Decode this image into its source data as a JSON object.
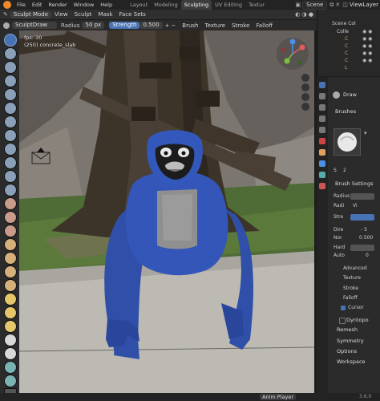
{
  "topbar": {
    "menus": [
      "File",
      "Edit",
      "Render",
      "Window",
      "Help"
    ],
    "tabs": [
      "Layout",
      "Modeling",
      "Sculpting",
      "UV Editing",
      "Textur"
    ],
    "active_tab": "Sculpting",
    "scene": "Scene",
    "view_layer": "ViewLayer"
  },
  "header": {
    "mode": "Sculpt Mode",
    "menus": [
      "View",
      "Sculpt",
      "Mask",
      "Face Sets"
    ],
    "brush_name": "SculptDraw",
    "radius_label": "Radius",
    "radius_value": "50 px",
    "strength_label": "Strength",
    "strength_value": "0.500",
    "right_menus": [
      "Brush",
      "Texture",
      "Stroke",
      "Falloff"
    ]
  },
  "viewport": {
    "info_line1": "fps: 30",
    "info_line2": "(250) concrete_slab"
  },
  "outliner": {
    "title": "Scene Col",
    "rows": [
      "Colle",
      "C",
      "C",
      "C",
      "C",
      "L"
    ]
  },
  "properties": {
    "tool_name": "Draw",
    "brushes_label": "Brushes",
    "brush_slot_label": "S",
    "brush_users": "2",
    "brush_settings_label": "Brush Settings",
    "rows": [
      {
        "label": "Radius",
        "value": ""
      },
      {
        "label": "Radi",
        "value": "Vi"
      },
      {
        "label": "Stre",
        "value": ""
      },
      {
        "label": "Dire",
        "value": "- 5"
      },
      {
        "label": "Nor",
        "value": "0.500"
      },
      {
        "label": "Hard",
        "value": ""
      },
      {
        "label": "Auto",
        "value": "0"
      }
    ],
    "subsections": [
      "Advanced",
      "Texture",
      "Stroke",
      "Falloff",
      "Cursor"
    ],
    "dyntopo": "Dyntopo",
    "panels": [
      "Remesh",
      "Symmetry",
      "Options",
      "Workspace"
    ]
  },
  "statusbar": {
    "anim_player": "Anim Player",
    "version": "3.6.0"
  },
  "colors": {
    "accent_blue": "#4772b3",
    "blender_orange": "#ec8a2c",
    "gorilla_blue": "#2f4fa8"
  }
}
